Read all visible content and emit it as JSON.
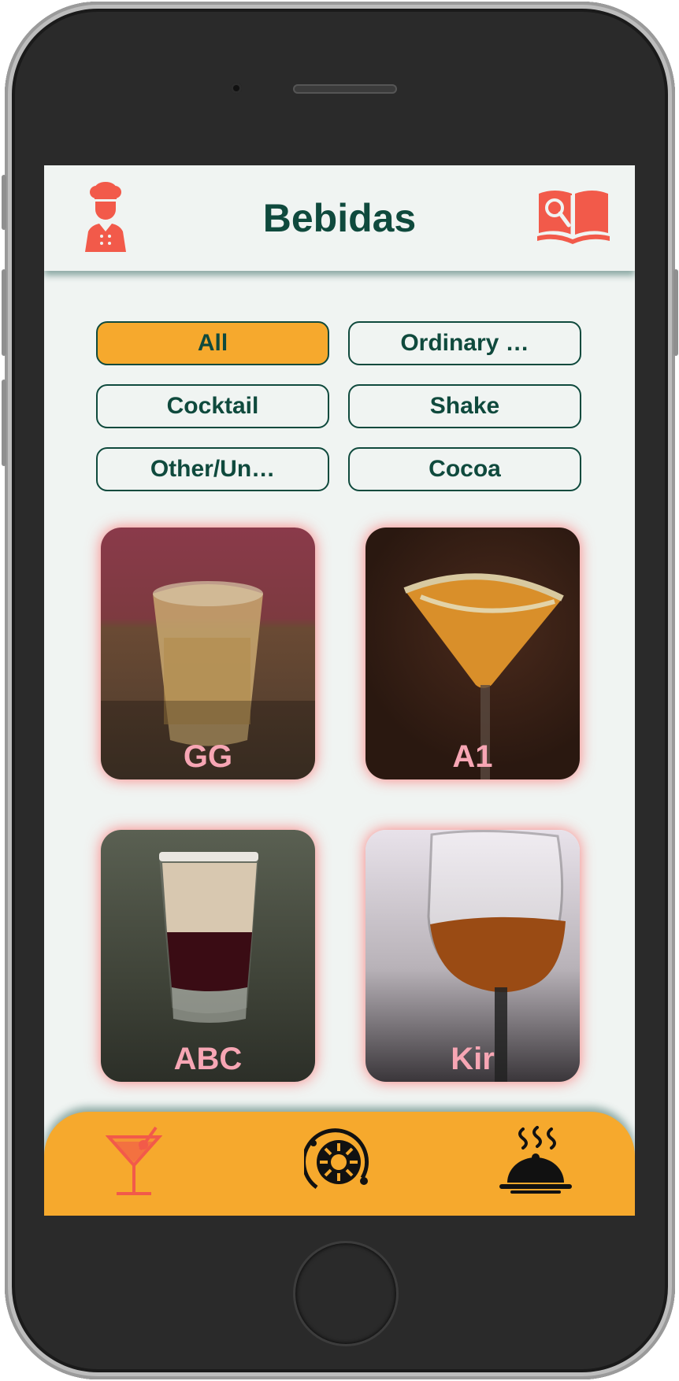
{
  "header": {
    "title": "Bebidas",
    "left_icon": "chef-icon",
    "right_icon": "recipe-book-search-icon"
  },
  "filters": [
    {
      "label": "All",
      "active": true
    },
    {
      "label": "Ordinary …",
      "active": false
    },
    {
      "label": "Cocktail",
      "active": false
    },
    {
      "label": "Shake",
      "active": false
    },
    {
      "label": "Other/Un…",
      "active": false
    },
    {
      "label": "Cocoa",
      "active": false
    }
  ],
  "drinks": [
    {
      "name": "GG"
    },
    {
      "name": "A1"
    },
    {
      "name": "ABC"
    },
    {
      "name": "Kir"
    }
  ],
  "nav": [
    {
      "icon": "cocktail-icon",
      "active": true
    },
    {
      "icon": "explore-icon",
      "active": false
    },
    {
      "icon": "food-cloche-icon",
      "active": false
    }
  ],
  "colors": {
    "primary": "#0f4a3d",
    "accent": "#f6a92d",
    "icon_red": "#f25a4a",
    "background": "#f0f4f2",
    "card_label": "#f7a6b4"
  }
}
